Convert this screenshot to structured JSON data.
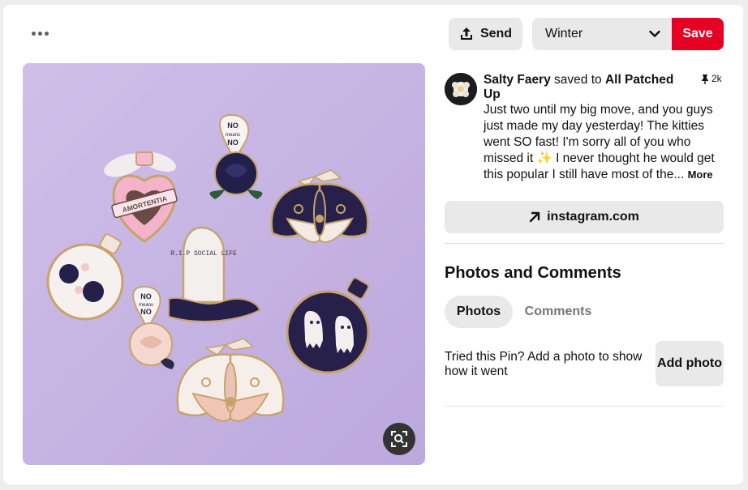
{
  "header": {
    "more_label": "More options",
    "send_label": "Send",
    "board_value": "Winter",
    "save_label": "Save"
  },
  "pin": {
    "saver_name": "Salty Faery",
    "saved_to_text": " saved to ",
    "board_name": "All Patched Up",
    "saves_count": "2k",
    "description": "Just two until my big move, and you guys just made my day yesterday! The kitties went SO fast! I'm sorry all of you who missed it ✨ I never thought he would get this popular I still have most of the...",
    "more_label": "More",
    "link_label": "instagram.com",
    "pin_texts": {
      "heart": "AMORTENTIA",
      "no_means_no": "NO means NO",
      "grave": "R.I.P SOCIAL LIFE"
    }
  },
  "comments": {
    "title": "Photos and Comments",
    "tabs": [
      "Photos",
      "Comments"
    ],
    "tried_text": "Tried this Pin? Add a photo to show how it went",
    "add_photo_label": "Add photo"
  },
  "colors": {
    "accent": "#e60023",
    "button_bg": "#e9e9e9",
    "image_bg": "#c9b7e4"
  },
  "icons": [
    "more-dots-icon",
    "share-icon",
    "chevron-down-icon",
    "pin-icon",
    "arrow-up-right-icon",
    "lens-icon"
  ]
}
